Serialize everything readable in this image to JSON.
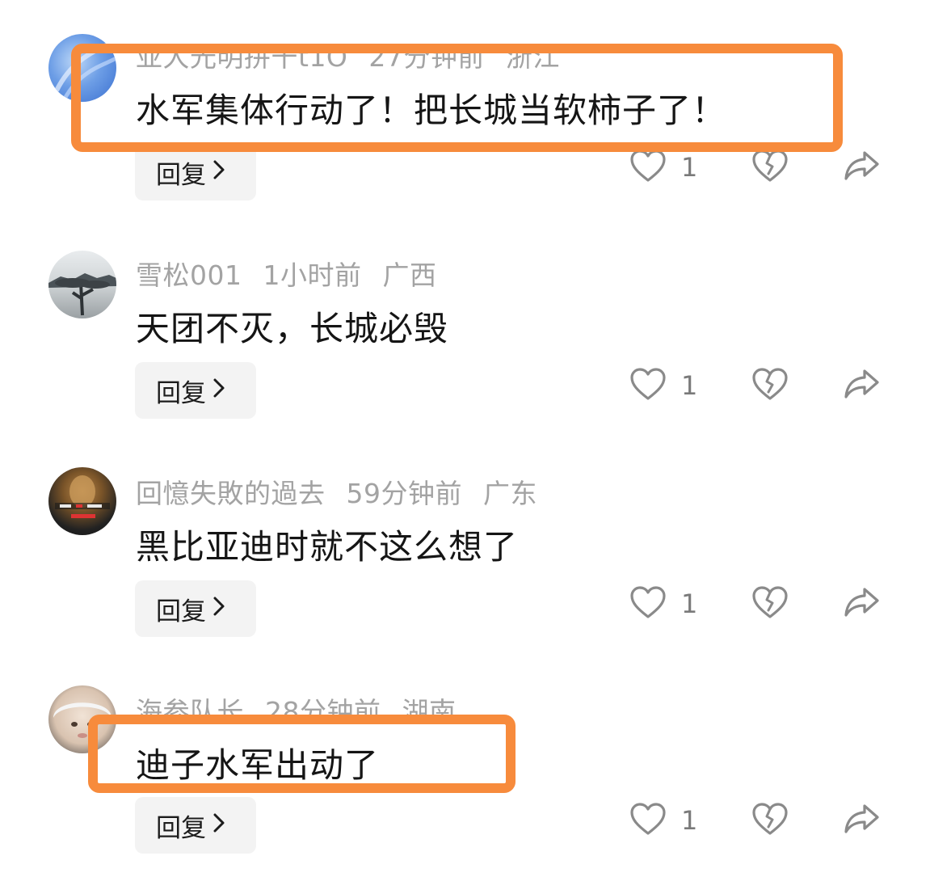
{
  "comments": [
    {
      "user": "亚大光明拼干t1O",
      "time": "27分钟前",
      "location": "浙江",
      "text": "水军集体行动了！把长城当软柿子了！",
      "reply_label": "回复",
      "likes": "1"
    },
    {
      "user": "雪松001",
      "time": "1小时前",
      "location": "广西",
      "text": "天团不灭，长城必毁",
      "reply_label": "回复",
      "likes": "1"
    },
    {
      "user": "回憶失敗的過去",
      "time": "59分钟前",
      "location": "广东",
      "text": "黑比亚迪时就不这么想了",
      "reply_label": "回复",
      "likes": "1"
    },
    {
      "user": "海参队长",
      "time": "28分钟前",
      "location": "湖南",
      "text": "迪子水军出动了",
      "reply_label": "回复",
      "likes": "1"
    }
  ],
  "icons": {
    "like": "heart-outline-icon",
    "dislike": "broken-heart-icon",
    "share": "share-arrow-icon",
    "reply_chevron": "chevron-right-icon"
  },
  "colors": {
    "highlight": "#f78b3c",
    "meta_text": "#a3a3a3",
    "icon": "#8a8a8a"
  }
}
